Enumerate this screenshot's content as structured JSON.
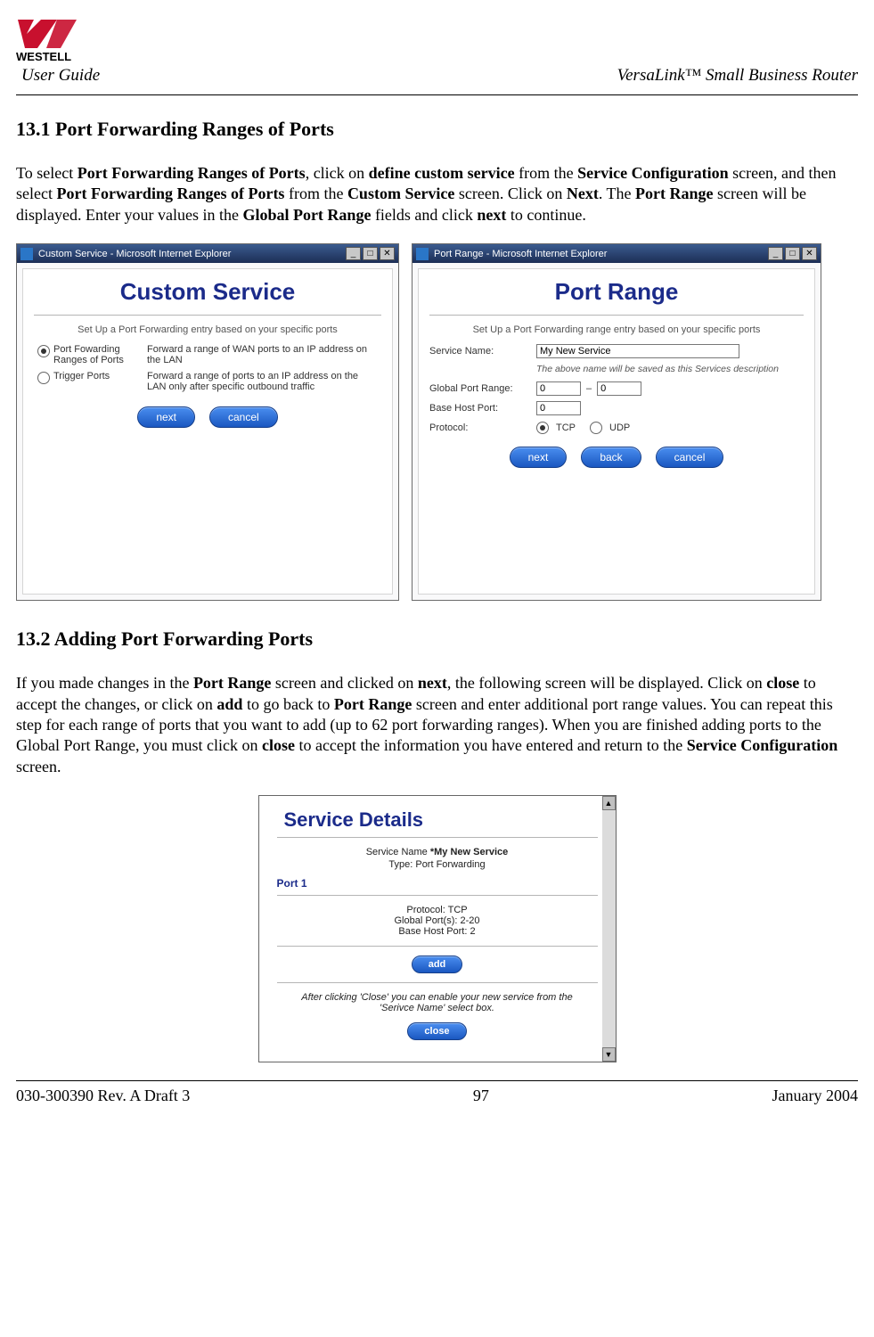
{
  "header": {
    "brand": "WESTELL",
    "user_guide": "User Guide",
    "product": "VersaLink™  Small Business Router"
  },
  "section1": {
    "heading": "13.1 Port Forwarding Ranges of Ports",
    "para_parts": {
      "p1": "To select ",
      "b1": "Port Forwarding Ranges of Ports",
      "p2": ", click on ",
      "b2": "define custom service",
      "p3": " from the ",
      "b3": "Service Configuration",
      "p4": " screen, and then select ",
      "b4": "Port Forwarding Ranges of Ports",
      "p5": " from the ",
      "b5": "Custom Service",
      "p6": " screen. Click on ",
      "b6": "Next",
      "p7": ". The ",
      "b7": "Port Range",
      "p8": " screen will be displayed. Enter your values in the ",
      "b8": "Global Port Range",
      "p9": " fields and click ",
      "b9": "next",
      "p10": " to continue."
    }
  },
  "fig1": {
    "titlebar": "Custom Service - Microsoft Internet Explorer",
    "heading": "Custom Service",
    "subtext": "Set Up a Port Forwarding entry based on your specific ports",
    "opt1_label": "Port Fowarding Ranges of Ports",
    "opt1_desc": "Forward a range of WAN ports to an IP address on the LAN",
    "opt2_label": "Trigger Ports",
    "opt2_desc": "Forward a range of ports to an IP address on the LAN only after specific outbound traffic",
    "btn_next": "next",
    "btn_cancel": "cancel"
  },
  "fig2": {
    "titlebar": "Port Range - Microsoft Internet Explorer",
    "heading": "Port Range",
    "subtext": "Set Up a Port Forwarding range entry based on your specific ports",
    "lbl_service": "Service Name:",
    "val_service": "My New Service",
    "note": "The above name will be saved as this Services description",
    "lbl_global": "Global Port Range:",
    "val_global_a": "0",
    "dash": "–",
    "val_global_b": "0",
    "lbl_base": "Base Host Port:",
    "val_base": "0",
    "lbl_proto": "Protocol:",
    "proto_tcp": "TCP",
    "proto_udp": "UDP",
    "btn_next": "next",
    "btn_back": "back",
    "btn_cancel": "cancel"
  },
  "section2": {
    "heading": "13.2 Adding Port Forwarding Ports",
    "para_parts": {
      "p1": "If you made changes in the ",
      "b1": "Port Range",
      "p2": " screen and clicked on ",
      "b2": "next",
      "p3": ", the following screen will be displayed. Click on ",
      "b3": "close",
      "p4": " to accept the changes, or click on ",
      "b4": "add",
      "p5": " to go back to ",
      "b5": "Port Range",
      "p6": " screen and enter additional port range values. You can repeat this step for each range of ports that you want to add (up to 62 port forwarding ranges). When you are finished adding ports to the Global Port Range, you must click on ",
      "b6": "close",
      "p7": " to accept the information you have entered and return to the ",
      "b7": "Service Configuration",
      "p8": " screen."
    }
  },
  "fig3": {
    "heading": "Service Details",
    "svc_label": "Service Name ",
    "svc_value": "*My New Service",
    "type_line": "Type: Port Forwarding",
    "port_label": "Port 1",
    "protocol": "Protocol: TCP",
    "global_ports": "Global Port(s): 2-20",
    "base_host": "Base Host Port: 2",
    "btn_add": "add",
    "note": "After clicking 'Close' you can enable your new service from the 'Serivce Name' select box.",
    "btn_close": "close"
  },
  "footer": {
    "left": "030-300390 Rev. A Draft 3",
    "center": "97",
    "right": "January 2004"
  },
  "win_controls": {
    "min": "_",
    "max": "□",
    "close": "✕"
  }
}
